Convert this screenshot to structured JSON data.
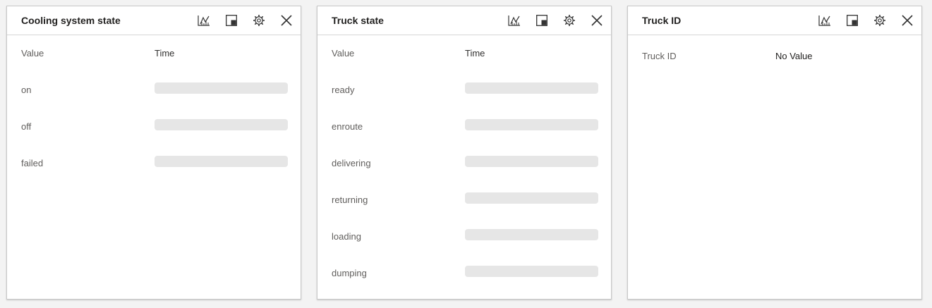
{
  "colors": {
    "page_background": "#f3f3f3",
    "tile_background": "#ffffff",
    "placeholder_bar": "#e6e6e6",
    "title_text": "#201f1e",
    "muted_text": "#605e5c"
  },
  "tile_tools": [
    "chart-icon",
    "pin-icon",
    "gear-icon",
    "close-icon"
  ],
  "tiles": [
    {
      "title": "Cooling system state",
      "columns": {
        "value": "Value",
        "time": "Time"
      },
      "rows": [
        "on",
        "off",
        "failed"
      ]
    },
    {
      "title": "Truck state",
      "columns": {
        "value": "Value",
        "time": "Time"
      },
      "rows": [
        "ready",
        "enroute",
        "delivering",
        "returning",
        "loading",
        "dumping"
      ]
    },
    {
      "title": "Truck ID",
      "field": {
        "label": "Truck ID",
        "value": "No Value"
      }
    }
  ]
}
